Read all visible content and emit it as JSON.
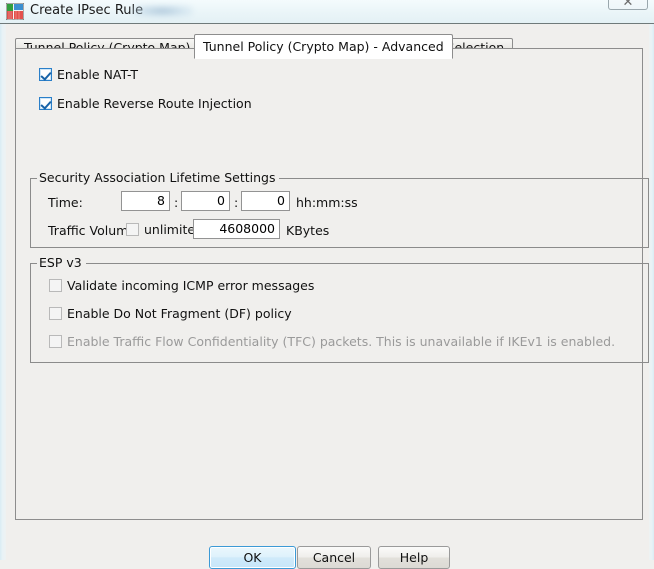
{
  "window": {
    "title": "Create IPsec Rule",
    "icon": "ipsec-rule-icon",
    "close_label": "✕"
  },
  "tabs": [
    {
      "id": "basic",
      "label": "Tunnel Policy (Crypto Map) - Basic",
      "selected": false
    },
    {
      "id": "advanced",
      "label": "Tunnel Policy (Crypto Map) - Advanced",
      "selected": true
    },
    {
      "id": "traffic",
      "label": "Traffic Selection",
      "selected": false
    }
  ],
  "top_options": [
    {
      "label": "Enable NAT-T",
      "checked": true,
      "enabled": true
    },
    {
      "label": "Enable Reverse Route Injection",
      "checked": true,
      "enabled": true
    }
  ],
  "sa_group": {
    "title": "Security Association Lifetime Settings",
    "time_label": "Time:",
    "time_hours": "8",
    "time_minutes": "0",
    "time_seconds": "0",
    "separator": ":",
    "time_format_label": "hh:mm:ss",
    "traffic_volume_label": "Traffic Volume:",
    "unlimited_label": "unlimited",
    "unlimited_checked": false,
    "traffic_volume_value": "4608000",
    "traffic_volume_units": "KBytes"
  },
  "esp_group": {
    "title": "ESP v3",
    "options": [
      {
        "label": "Validate incoming ICMP error messages",
        "checked": false,
        "enabled": true
      },
      {
        "label": "Enable Do Not Fragment (DF)  policy",
        "checked": false,
        "enabled": true
      },
      {
        "label": "Enable Traffic Flow Confidentiality (TFC) packets. This is unavailable if IKEv1 is enabled.",
        "checked": false,
        "enabled": false
      }
    ]
  },
  "buttons": {
    "ok": "OK",
    "cancel": "Cancel",
    "help": "Help"
  },
  "colors": {
    "dialog_background": "#f0efed",
    "titlebar_gradient_top": "#f4fbfd",
    "titlebar_gradient_bottom": "#e4f1f5",
    "checkbox_checked_border": "#2a7fc9",
    "checkbox_check_mark": "#1763a8",
    "focus_button_border": "#3c9ad6",
    "disabled_text": "#9a9a9a",
    "border_gray": "#8b8b8b",
    "field_background": "#ffffff"
  }
}
